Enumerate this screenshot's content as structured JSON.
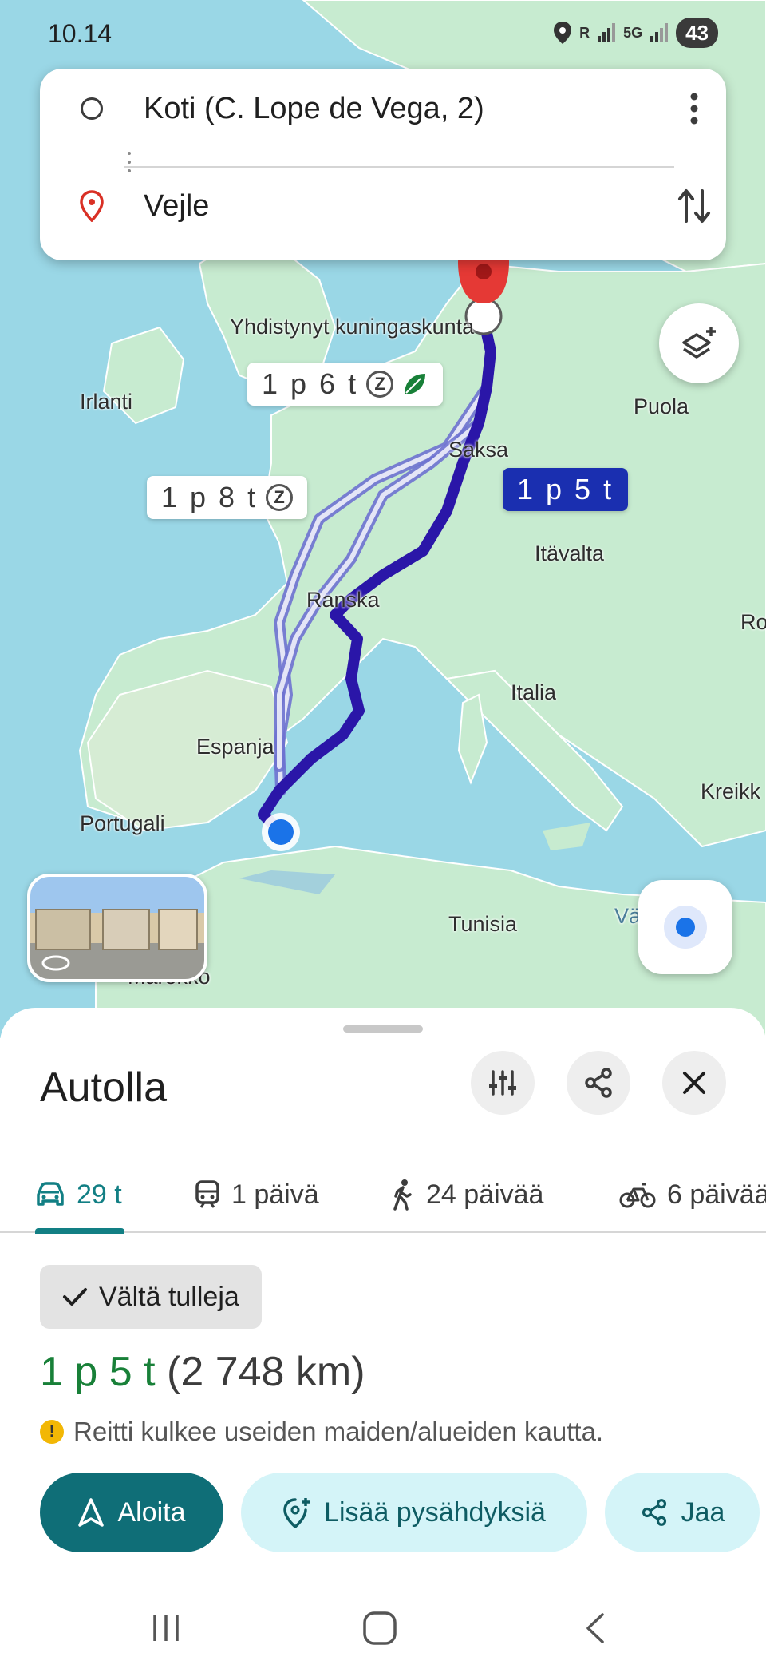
{
  "status": {
    "time": "10.14",
    "battery": "43",
    "signal_labels": [
      "R",
      "5G"
    ]
  },
  "route_inputs": {
    "origin": "Koti (C. Lope de Vega, 2)",
    "destination": "Vejle"
  },
  "map": {
    "labels": {
      "uk": "Yhdistynyt kuningaskunta",
      "ireland": "Irlanti",
      "poland": "Puola",
      "germany": "Saksa",
      "austria": "Itävalta",
      "france": "Ranska",
      "italy": "Italia",
      "spain": "Espanja",
      "portugal": "Portugali",
      "greece": "Kreikk",
      "romania": "Ro",
      "tunisia": "Tunisia",
      "morocco": "Marokko",
      "mediterranean": "Vä"
    },
    "route_options": [
      {
        "label": "1 p 6 t",
        "eco": true
      },
      {
        "label": "1 p 8 t"
      },
      {
        "label": "1 p 5 t",
        "selected": true
      }
    ]
  },
  "sheet": {
    "title": "Autolla",
    "modes": [
      {
        "icon": "car-icon",
        "label": "29 t",
        "active": true
      },
      {
        "icon": "transit-icon",
        "label": "1 päivä"
      },
      {
        "icon": "walk-icon",
        "label": "24 päivää"
      },
      {
        "icon": "bike-icon",
        "label": "6 päivää"
      }
    ],
    "chip": "Vältä tulleja",
    "duration": "1 p 5 t",
    "distance": "(2 748 km)",
    "warning": "Reitti kulkee useiden maiden/alueiden kautta.",
    "actions": {
      "start": "Aloita",
      "add_stops": "Lisää pysähdyksiä",
      "share": "Jaa"
    }
  },
  "colors": {
    "accent": "#127f84",
    "route_selected": "#1a2fb0",
    "route_alt": "#7b7fd6",
    "duration_green": "#188038"
  }
}
